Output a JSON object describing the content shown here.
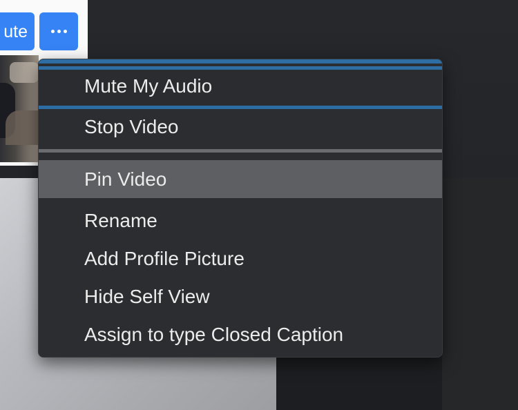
{
  "self_view": {
    "unmute_label": "ute",
    "more_icon": "ellipsis-horizontal-icon"
  },
  "context_menu": {
    "group1": [
      {
        "label": "Mute My Audio",
        "state": "focused"
      },
      {
        "label": "Stop Video",
        "state": "normal"
      }
    ],
    "group2": [
      {
        "label": "Pin Video",
        "state": "hovered"
      },
      {
        "label": "Rename",
        "state": "normal"
      },
      {
        "label": "Add Profile Picture",
        "state": "normal"
      },
      {
        "label": "Hide Self View",
        "state": "normal"
      },
      {
        "label": "Assign to type Closed Caption",
        "state": "normal"
      }
    ]
  },
  "colors": {
    "accent_blue": "#3583f5",
    "focus_ring": "#2e6da4",
    "menu_bg": "#2c2d30",
    "hover_bg": "#5e5f62",
    "text": "#ececec"
  }
}
